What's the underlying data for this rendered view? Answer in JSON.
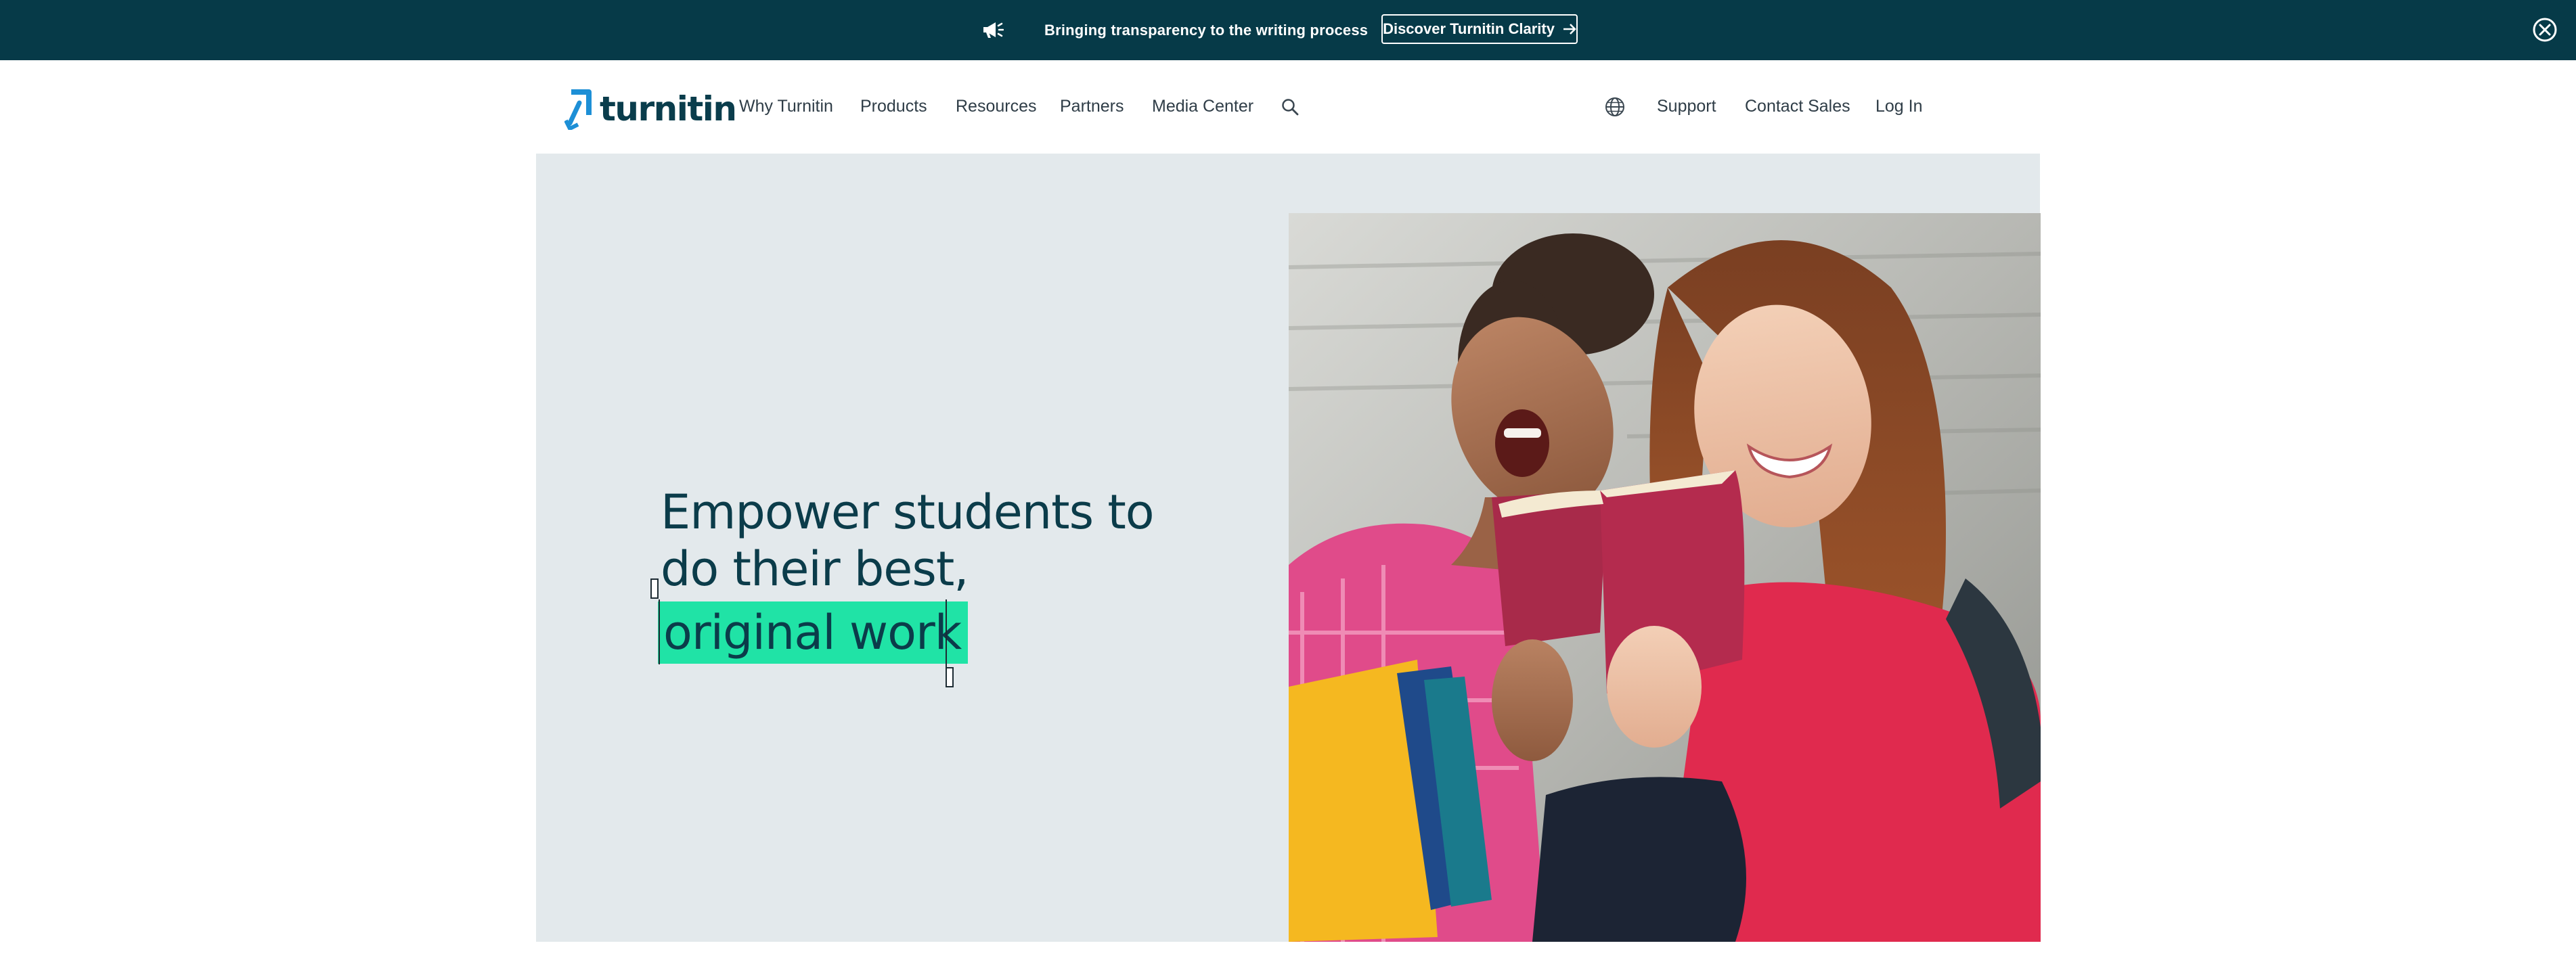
{
  "announcement": {
    "message": "Bringing transparency to the writing process",
    "cta_label": "Discover Turnitin Clarity",
    "cta_arrow": "→",
    "icon": "megaphone-icon",
    "close_icon": "close-circle-icon"
  },
  "nav": {
    "logo_text": "turnitin",
    "items": [
      {
        "label": "Why Turnitin"
      },
      {
        "label": "Products"
      },
      {
        "label": "Resources"
      },
      {
        "label": "Partners"
      },
      {
        "label": "Media Center"
      }
    ],
    "search_icon": "search-icon",
    "globe_icon": "globe-icon",
    "right_items": [
      {
        "label": "Support"
      },
      {
        "label": "Contact Sales"
      },
      {
        "label": "Log In"
      }
    ]
  },
  "hero": {
    "headline_line1": "Empower students to",
    "headline_line2": "do their best,",
    "headline_highlight": "original work",
    "image": "students-reading-book-photo"
  },
  "colors": {
    "announcement_bg": "#063a48",
    "brand_dark": "#0a3d4c",
    "brand_blue": "#1d8fd6",
    "highlight": "#20e3a6",
    "hero_bg": "#e3e9ec"
  }
}
